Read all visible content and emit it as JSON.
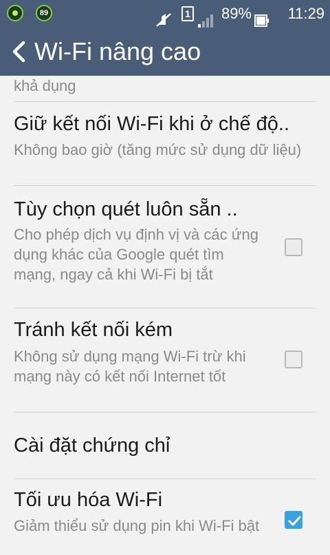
{
  "status_bar": {
    "notif_badge": "89",
    "sim_slot": "1",
    "battery": "89%",
    "time": "11:29",
    "icons": [
      "app-notification-icon",
      "counter-badge-icon",
      "silent-mode-icon",
      "sim-card-icon",
      "signal-icon",
      "battery-icon"
    ]
  },
  "app_bar": {
    "title": "Wi-Fi nâng cao",
    "back_icon": "chevron-left-icon"
  },
  "colors": {
    "header": "#4a5d78",
    "background": "#f2f2f2",
    "accent": "#39a3dd"
  },
  "settings": [
    {
      "title": "",
      "summary": "khả dụng"
    },
    {
      "title": "Giữ kết nối Wi-Fi khi ở chế độ..",
      "summary": "Không bao giờ (tăng mức sử dụng dữ liệu)"
    },
    {
      "title": "Tùy chọn quét luôn sẵn ..",
      "summary": "Cho phép dịch vụ định vị và các ứng dụng khác của Google quét tìm mạng, ngay cả khi Wi-Fi bị tắt",
      "checked": false
    },
    {
      "title": "Tránh kết nối kém",
      "summary": "Không sử dụng mạng Wi-Fi trừ khi mạng này có kết nối Internet tốt",
      "checked": false
    },
    {
      "title": "Cài đặt chứng chỉ",
      "summary": ""
    },
    {
      "title": "Tối ưu hóa Wi-Fi",
      "summary": "Giảm thiểu sử dụng pin khi Wi-Fi bật",
      "checked": true
    }
  ]
}
